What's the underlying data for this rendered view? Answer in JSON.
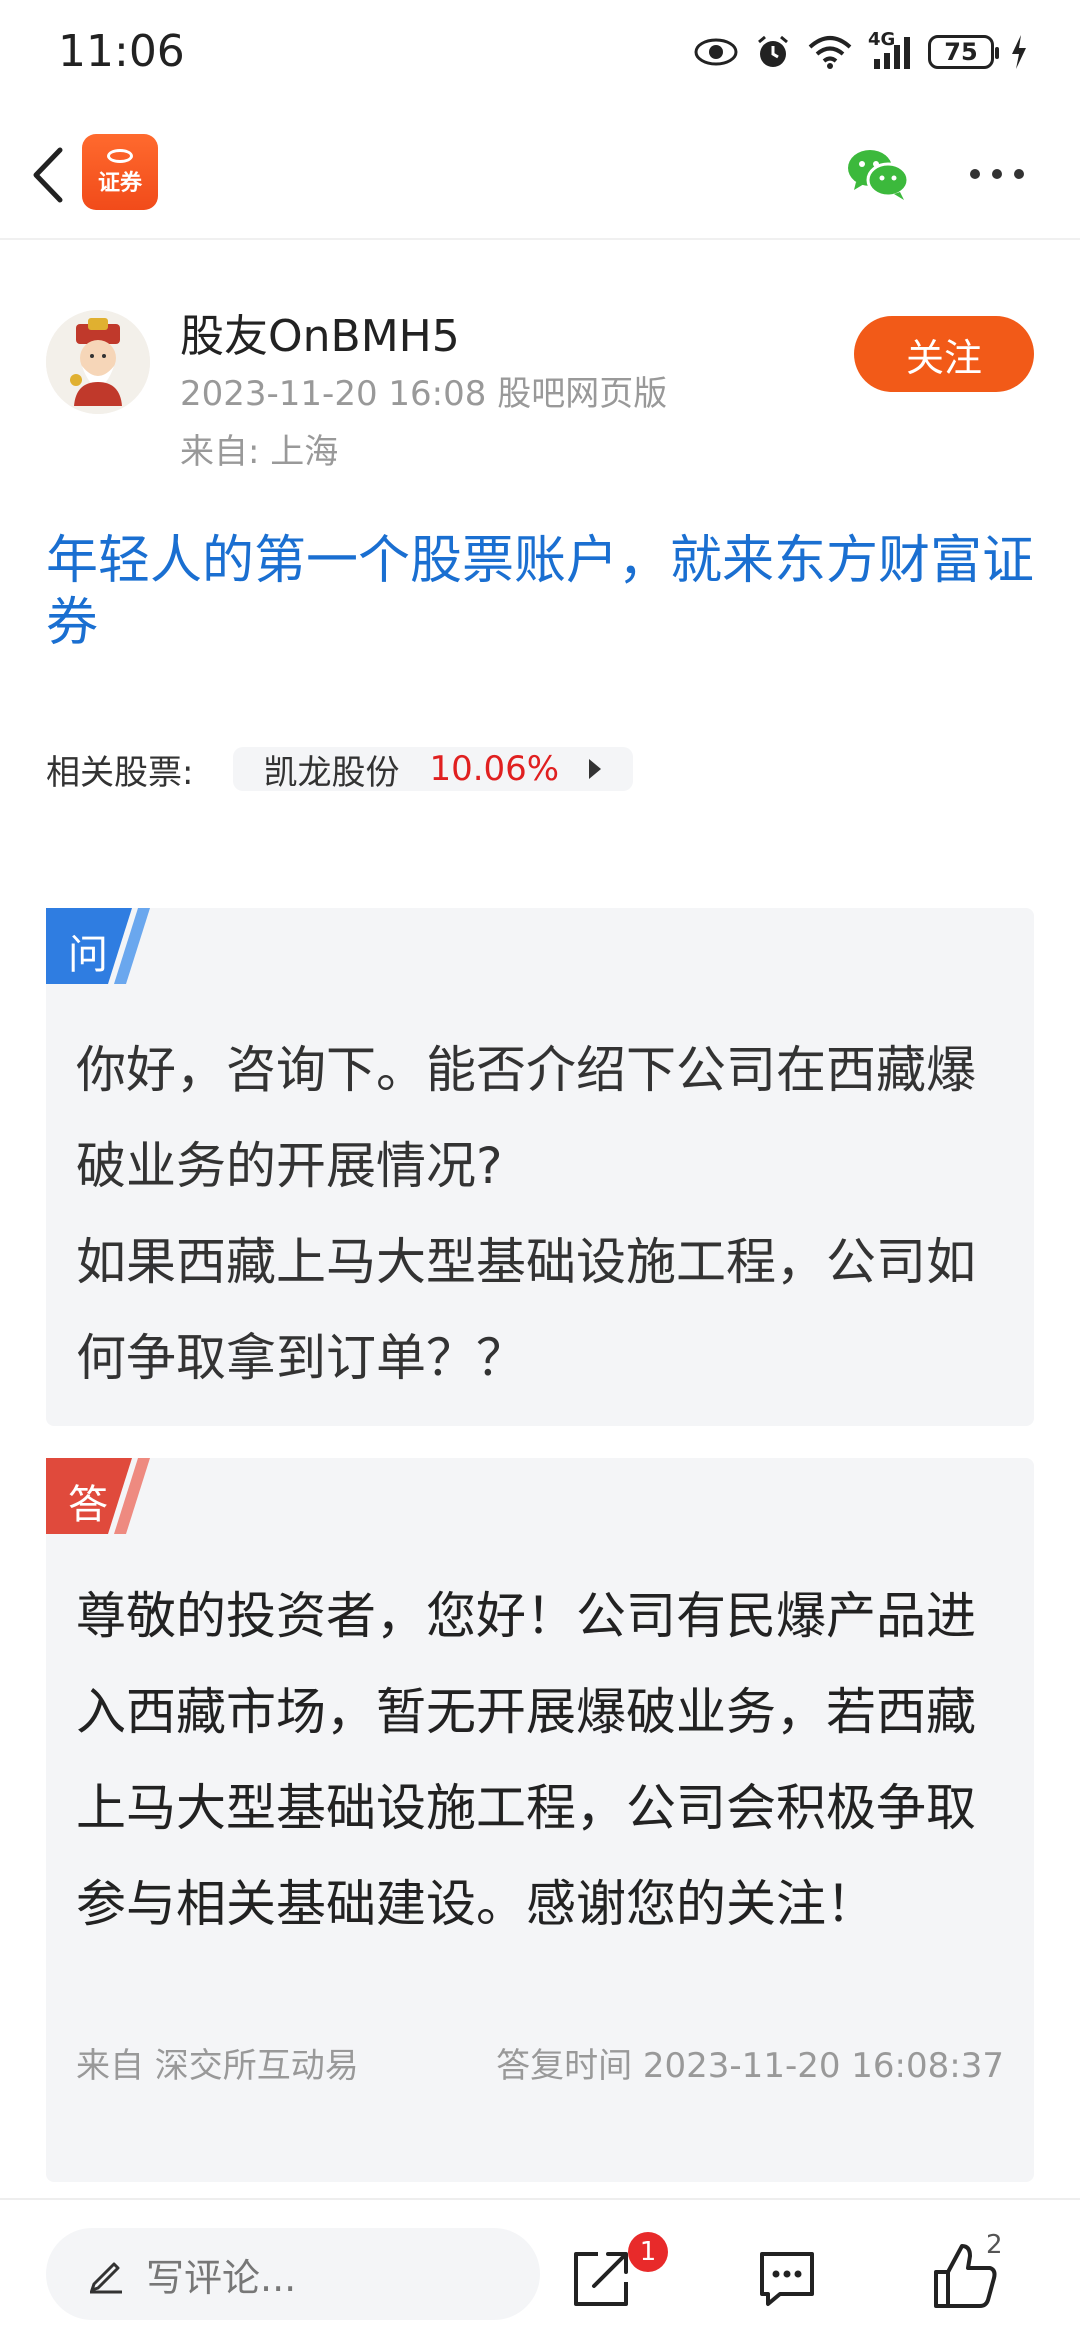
{
  "status_bar": {
    "time": "11:06",
    "network": "4G",
    "battery": "75",
    "icons": [
      "eye-icon",
      "alarm-icon",
      "wifi-icon",
      "signal-icon",
      "battery-icon",
      "charging-icon"
    ]
  },
  "nav": {
    "logo_text": "证券",
    "icons": [
      "back-arrow-icon",
      "wechat-share-icon",
      "more-icon"
    ]
  },
  "author": {
    "name": "股友OnBMH5",
    "meta": "2023-11-20 16:08 股吧网页版",
    "location": "来自: 上海",
    "follow_label": "关注"
  },
  "post": {
    "title": "年轻人的第一个股票账户，就来东方财富证券"
  },
  "related": {
    "label": "相关股票:",
    "stock_name": "凯龙股份",
    "stock_change": "10.06%"
  },
  "question": {
    "tag": "问",
    "text": "你好，咨询下。能否介绍下公司在西藏爆破业务的开展情况?\n如果西藏上马大型基础设施工程，公司如何争取拿到订单？？"
  },
  "answer": {
    "tag": "答",
    "text": "尊敬的投资者，您好！公司有民爆产品进入西藏市场，暂无开展爆破业务，若西藏上马大型基础设施工程，公司会积极争取参与相关基础建设。感谢您的关注！",
    "source": "来自 深交所互动易",
    "reply_time": "答复时间 2023-11-20 16:08:37"
  },
  "bottom_bar": {
    "comment_placeholder": "写评论...",
    "share_badge": "1",
    "like_count": "2"
  },
  "colors": {
    "accent": "#f25a18",
    "title_blue": "#1a6fd1",
    "question_tag": "#2f7de1",
    "answer_tag": "#e04a3c",
    "up_red": "#e02020"
  }
}
